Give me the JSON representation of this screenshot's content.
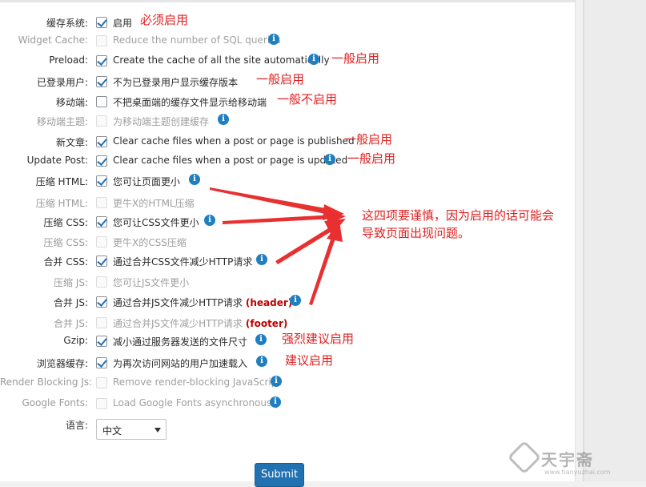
{
  "settings": {
    "rows": [
      {
        "label": "缓存系统:",
        "option": "启用",
        "checked": true,
        "disabled": false,
        "info": false,
        "note": "必须启用"
      },
      {
        "label": "Widget Cache:",
        "option": "Reduce the number of SQL queries",
        "checked": false,
        "disabled": true,
        "info": true,
        "note": ""
      },
      {
        "label": "Preload:",
        "option": "Create the cache of all the site automatically",
        "checked": true,
        "disabled": false,
        "info": true,
        "note": "一般启用"
      },
      {
        "label": "已登录用户:",
        "option": "不为已登录用户显示缓存版本",
        "checked": true,
        "disabled": false,
        "info": false,
        "note": "一般启用"
      },
      {
        "label": "移动端:",
        "option": "不把桌面端的缓存文件显示给移动端",
        "checked": false,
        "disabled": false,
        "info": false,
        "note": "一般不启用"
      },
      {
        "label": "移动端主题:",
        "option": "为移动端主题创建缓存",
        "checked": false,
        "disabled": true,
        "info": true,
        "note": ""
      },
      {
        "label": "新文章:",
        "option": "Clear cache files when a post or page is published",
        "checked": true,
        "disabled": false,
        "info": false,
        "note": "一般启用"
      },
      {
        "label": "Update Post:",
        "option": "Clear cache files when a post or page is updated",
        "checked": true,
        "disabled": false,
        "info": true,
        "note": "一般启用"
      },
      {
        "label": "压缩 HTML:",
        "option": "您可让页面更小",
        "checked": true,
        "disabled": false,
        "info": true,
        "note": ""
      },
      {
        "label": "压缩 HTML:",
        "option": "更牛X的HTML压缩",
        "checked": false,
        "disabled": true,
        "info": false,
        "note": ""
      },
      {
        "label": "压缩 CSS:",
        "option": "您可让CSS文件更小",
        "checked": true,
        "disabled": false,
        "info": true,
        "note": ""
      },
      {
        "label": "压缩 CSS:",
        "option": "更牛X的CSS压缩",
        "checked": false,
        "disabled": true,
        "info": false,
        "note": ""
      },
      {
        "label": "合并 CSS:",
        "option": "通过合并CSS文件减少HTTP请求",
        "checked": true,
        "disabled": false,
        "info": true,
        "note": ""
      },
      {
        "label": "压缩 JS:",
        "option": "您可让JS文件更小",
        "checked": false,
        "disabled": true,
        "info": false,
        "note": ""
      },
      {
        "label": "合并 JS:",
        "option": "通过合并JS文件减少HTTP请求",
        "suffix": "(header)",
        "checked": true,
        "disabled": false,
        "info": true,
        "note": ""
      },
      {
        "label": "合并 JS:",
        "option": "通过合并JS文件减少HTTP请求",
        "suffix": "(footer)",
        "checked": false,
        "disabled": true,
        "info": false,
        "note": ""
      },
      {
        "label": "Gzip:",
        "option": "减小通过服务器发送的文件尺寸",
        "checked": true,
        "disabled": false,
        "info": true,
        "note": "强烈建议启用"
      },
      {
        "label": "浏览器缓存:",
        "option": "为再次访问网站的用户加速载入",
        "checked": true,
        "disabled": false,
        "info": true,
        "note": "建议启用"
      },
      {
        "label": "Render Blocking Js:",
        "option": "Remove render-blocking JavaScript",
        "checked": false,
        "disabled": true,
        "info": true,
        "note": ""
      },
      {
        "label": "Google Fonts:",
        "option": "Load Google Fonts asynchronously",
        "checked": false,
        "disabled": true,
        "info": true,
        "note": ""
      }
    ],
    "language_label": "语言:",
    "language_value": "中文",
    "submit_label": "Submit"
  },
  "annotation": {
    "line1": "这四项要谨慎，因为启用的话可能会",
    "line2": "导致页面出现问题。"
  },
  "watermark": {
    "name": "天宇斋",
    "url": "www.tianyuzhai.com"
  },
  "colors": {
    "note_red": "#e02020",
    "info_blue": "#1f7fbf",
    "submit_blue": "#2271b1"
  }
}
